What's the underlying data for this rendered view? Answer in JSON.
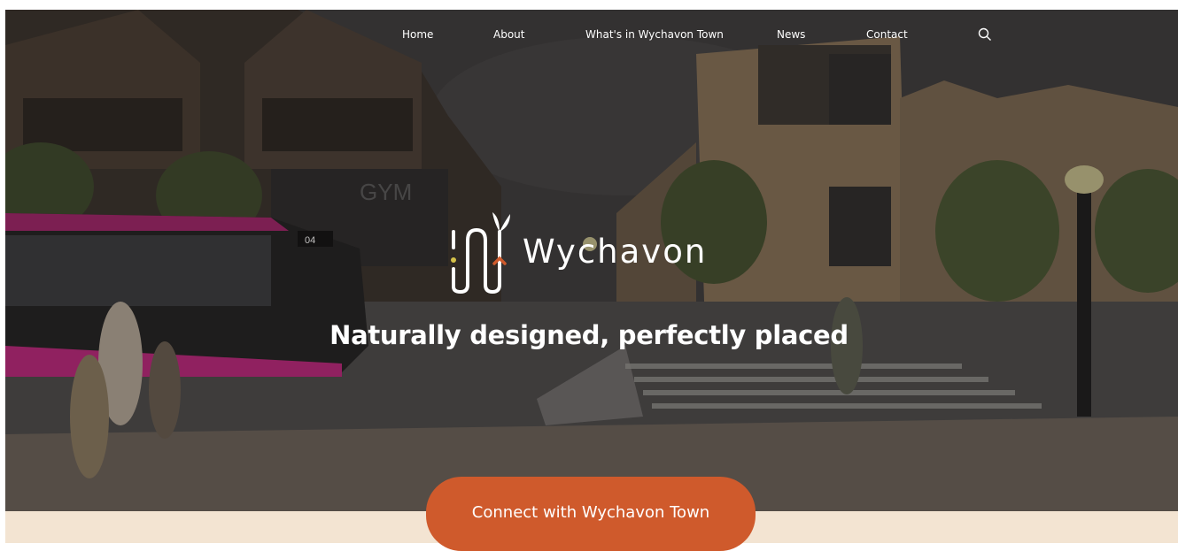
{
  "nav": {
    "items": [
      {
        "label": "Home"
      },
      {
        "label": "About"
      },
      {
        "label": "What's in Wychavon Town"
      },
      {
        "label": "News"
      },
      {
        "label": "Contact"
      }
    ],
    "search_icon": "search-icon"
  },
  "brand": {
    "name": "Wychavon",
    "logo_icon": "sprout-path-logo-icon",
    "accent_color": "#cf5a2c"
  },
  "hero": {
    "tagline": "Naturally designed, perfectly placed",
    "bus_sign": "04",
    "building_sign": "GYM"
  },
  "cta": {
    "label": "Connect with Wychavon Town"
  },
  "colors": {
    "cta_background": "#cf5a2c",
    "footer_band": "#f3e4d2",
    "bus_accent": "#c0287e"
  }
}
